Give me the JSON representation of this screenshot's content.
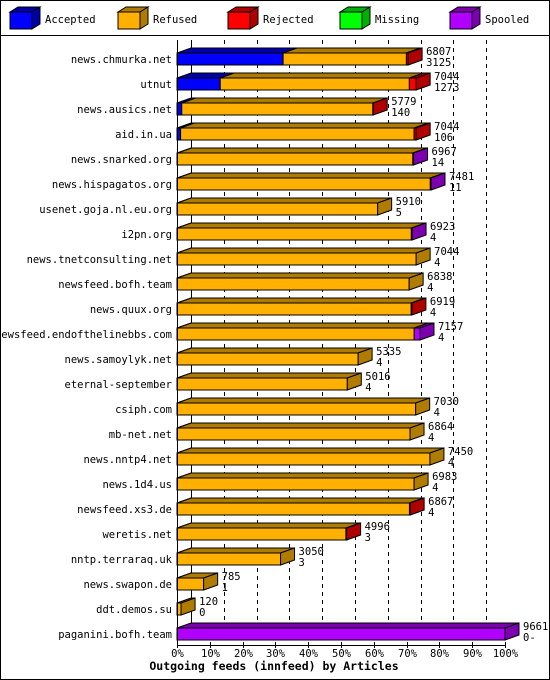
{
  "chart_data": {
    "type": "bar",
    "orientation": "horizontal",
    "stacked": true,
    "title": "Outgoing feeds (innfeed) by Articles",
    "xlim": [
      0,
      100
    ],
    "x_unit": "%",
    "x_ticks": [
      "0%",
      "10%",
      "20%",
      "30%",
      "40%",
      "50%",
      "60%",
      "70%",
      "80%",
      "90%",
      "100%"
    ],
    "grid": true,
    "legend_placement": "top",
    "legend": [
      {
        "key": "accepted",
        "label": "Accepted",
        "color": "#0000ff",
        "dark": "#0000a8"
      },
      {
        "key": "refused",
        "label": "Refused",
        "color": "#ffb000",
        "dark": "#b07c00"
      },
      {
        "key": "rejected",
        "label": "Rejected",
        "color": "#ff0000",
        "dark": "#b00000"
      },
      {
        "key": "missing",
        "label": "Missing",
        "color": "#00ff00",
        "dark": "#00b000"
      },
      {
        "key": "spooled",
        "label": "Spooled",
        "color": "#b000ff",
        "dark": "#7c00b0"
      }
    ],
    "rows": [
      {
        "name": "news.chmurka.net",
        "total": "6807",
        "accepted_label": "3125",
        "accepted": 3125,
        "refused": 3632,
        "rejected": 50,
        "missing": 0,
        "spooled": 0
      },
      {
        "name": "utnut",
        "total": "7044",
        "accepted_label": "1273",
        "accepted": 1273,
        "refused": 5571,
        "rejected": 200,
        "missing": 0,
        "spooled": 0
      },
      {
        "name": "news.ausics.net",
        "total": "5779",
        "accepted_label": "140",
        "accepted": 140,
        "refused": 5629,
        "rejected": 10,
        "missing": 0,
        "spooled": 0
      },
      {
        "name": "aid.in.ua",
        "total": "7044",
        "accepted_label": "106",
        "accepted": 106,
        "refused": 6878,
        "rejected": 60,
        "missing": 0,
        "spooled": 0
      },
      {
        "name": "news.snarked.org",
        "total": "6967",
        "accepted_label": "14",
        "accepted": 14,
        "refused": 6933,
        "rejected": 0,
        "missing": 0,
        "spooled": 20
      },
      {
        "name": "news.hispagatos.org",
        "total": "7481",
        "accepted_label": "11",
        "accepted": 11,
        "refused": 7450,
        "rejected": 0,
        "missing": 0,
        "spooled": 20
      },
      {
        "name": "usenet.goja.nl.eu.org",
        "total": "5910",
        "accepted_label": "5",
        "accepted": 5,
        "refused": 5905,
        "rejected": 0,
        "missing": 0,
        "spooled": 0
      },
      {
        "name": "i2pn.org",
        "total": "6923",
        "accepted_label": "4",
        "accepted": 4,
        "refused": 6899,
        "rejected": 0,
        "missing": 0,
        "spooled": 20
      },
      {
        "name": "news.tnetconsulting.net",
        "total": "7044",
        "accepted_label": "4",
        "accepted": 4,
        "refused": 7040,
        "rejected": 0,
        "missing": 0,
        "spooled": 0
      },
      {
        "name": "newsfeed.bofh.team",
        "total": "6838",
        "accepted_label": "4",
        "accepted": 4,
        "refused": 6834,
        "rejected": 0,
        "missing": 0,
        "spooled": 0
      },
      {
        "name": "news.quux.org",
        "total": "6919",
        "accepted_label": "4",
        "accepted": 4,
        "refused": 6895,
        "rejected": 20,
        "missing": 0,
        "spooled": 0
      },
      {
        "name": "newsfeed.endofthelinebbs.com",
        "total": "7157",
        "accepted_label": "4",
        "accepted": 4,
        "refused": 6983,
        "rejected": 0,
        "missing": 0,
        "spooled": 170
      },
      {
        "name": "news.samoylyk.net",
        "total": "5335",
        "accepted_label": "4",
        "accepted": 4,
        "refused": 5331,
        "rejected": 0,
        "missing": 0,
        "spooled": 0
      },
      {
        "name": "eternal-september",
        "total": "5016",
        "accepted_label": "4",
        "accepted": 4,
        "refused": 5012,
        "rejected": 0,
        "missing": 0,
        "spooled": 0
      },
      {
        "name": "csiph.com",
        "total": "7030",
        "accepted_label": "4",
        "accepted": 4,
        "refused": 7026,
        "rejected": 0,
        "missing": 0,
        "spooled": 0
      },
      {
        "name": "mb-net.net",
        "total": "6864",
        "accepted_label": "4",
        "accepted": 4,
        "refused": 6860,
        "rejected": 0,
        "missing": 0,
        "spooled": 0
      },
      {
        "name": "news.nntp4.net",
        "total": "7450",
        "accepted_label": "4",
        "accepted": 4,
        "refused": 7446,
        "rejected": 0,
        "missing": 0,
        "spooled": 0
      },
      {
        "name": "news.1d4.us",
        "total": "6983",
        "accepted_label": "4",
        "accepted": 4,
        "refused": 6979,
        "rejected": 0,
        "missing": 0,
        "spooled": 0
      },
      {
        "name": "newsfeed.xs3.de",
        "total": "6867",
        "accepted_label": "4",
        "accepted": 4,
        "refused": 6843,
        "rejected": 20,
        "missing": 0,
        "spooled": 0
      },
      {
        "name": "weretis.net",
        "total": "4996",
        "accepted_label": "3",
        "accepted": 3,
        "refused": 4973,
        "rejected": 20,
        "missing": 0,
        "spooled": 0
      },
      {
        "name": "nntp.terraraq.uk",
        "total": "3050",
        "accepted_label": "3",
        "accepted": 3,
        "refused": 3047,
        "rejected": 0,
        "missing": 0,
        "spooled": 0
      },
      {
        "name": "news.swapon.de",
        "total": "785",
        "accepted_label": "1",
        "accepted": 1,
        "refused": 784,
        "rejected": 0,
        "missing": 0,
        "spooled": 0
      },
      {
        "name": "ddt.demos.su",
        "total": "120",
        "accepted_label": "0",
        "accepted": 0,
        "refused": 120,
        "rejected": 0,
        "missing": 0,
        "spooled": 0
      },
      {
        "name": "paganini.bofh.team",
        "total": "9661",
        "accepted_label": "0-",
        "accepted": 0,
        "refused": 0,
        "rejected": 0,
        "missing": 0,
        "spooled": 9661
      }
    ],
    "max_total": 9661
  }
}
